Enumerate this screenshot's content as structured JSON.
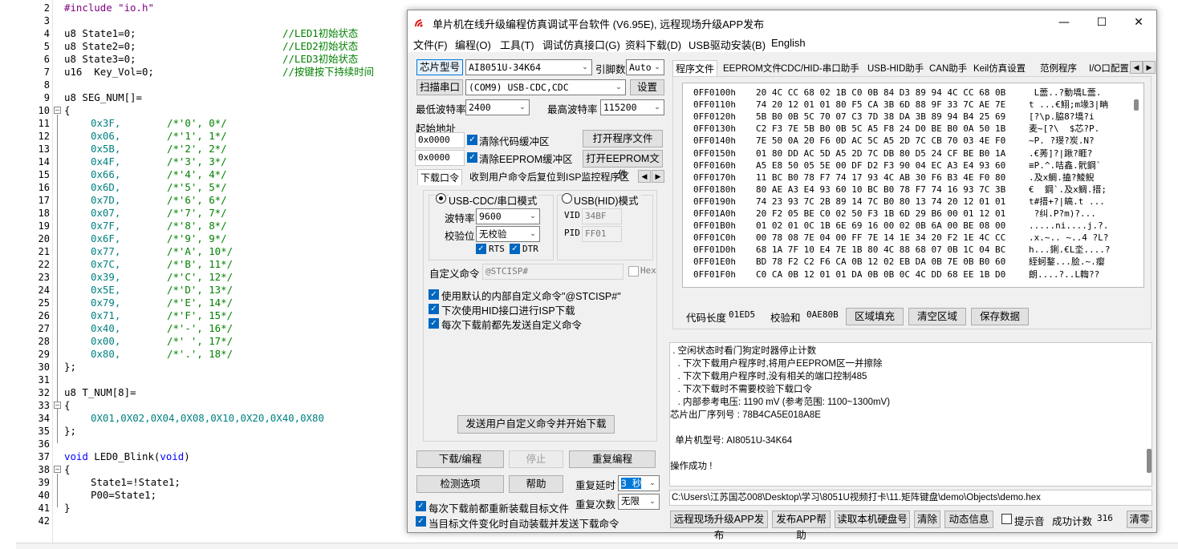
{
  "editor": {
    "line_numbers": [
      "2",
      "3",
      "4",
      "5",
      "6",
      "7",
      "8",
      "9",
      "10",
      "11",
      "12",
      "13",
      "14",
      "15",
      "16",
      "17",
      "18",
      "19",
      "20",
      "21",
      "22",
      "23",
      "24",
      "25",
      "26",
      "27",
      "28",
      "29",
      "30",
      "31",
      "32",
      "33",
      "34",
      "35",
      "36",
      "37",
      "38",
      "39",
      "40",
      "41",
      "42"
    ],
    "lines": {
      "l2_a": "#include ",
      "l2_b": "\"io.h\"",
      "l4_code": "u8 State1=0;",
      "l4_cmt": "//LED1初始状态",
      "l5_code": "u8 State2=0;",
      "l5_cmt": "//LED2初始状态",
      "l6_code": "u8 State3=0;",
      "l6_cmt": "//LED3初始状态",
      "l7_code": "u16  Key_Vol=0;",
      "l7_cmt": "//按键按下持续时间",
      "l9": "u8 SEG_NUM[]=",
      "l10": "{",
      "seg": [
        {
          "v": "0x3F,",
          "c": "/*'0', 0*/"
        },
        {
          "v": "0x06,",
          "c": "/*'1', 1*/"
        },
        {
          "v": "0x5B,",
          "c": "/*'2', 2*/"
        },
        {
          "v": "0x4F,",
          "c": "/*'3', 3*/"
        },
        {
          "v": "0x66,",
          "c": "/*'4', 4*/"
        },
        {
          "v": "0x6D,",
          "c": "/*'5', 5*/"
        },
        {
          "v": "0x7D,",
          "c": "/*'6', 6*/"
        },
        {
          "v": "0x07,",
          "c": "/*'7', 7*/"
        },
        {
          "v": "0x7F,",
          "c": "/*'8', 8*/"
        },
        {
          "v": "0x6F,",
          "c": "/*'9', 9*/"
        },
        {
          "v": "0x77,",
          "c": "/*'A', 10*/"
        },
        {
          "v": "0x7C,",
          "c": "/*'B', 11*/"
        },
        {
          "v": "0x39,",
          "c": "/*'C', 12*/"
        },
        {
          "v": "0x5E,",
          "c": "/*'D', 13*/"
        },
        {
          "v": "0x79,",
          "c": "/*'E', 14*/"
        },
        {
          "v": "0x71,",
          "c": "/*'F', 15*/"
        },
        {
          "v": "0x40,",
          "c": "/*'-', 16*/"
        },
        {
          "v": "0x00,",
          "c": "/*' ', 17*/"
        },
        {
          "v": "0x80,",
          "c": "/*'.', 18*/"
        }
      ],
      "l30": "};",
      "l32": "u8 T_NUM[8]=",
      "l33": "{",
      "l34": "0X01,0X02,0X04,0X08,0X10,0X20,0X40,0X80",
      "l35": "};",
      "l37_kw": "void",
      "l37_name": " LED0_Blink(",
      "l37_kw2": "void",
      "l37_end": ")",
      "l38": "{",
      "l39": "State1=!State1;",
      "l40": "P00=State1;",
      "l41": "}"
    }
  },
  "window": {
    "title": "单片机在线升级编程仿真调试平台软件 (V6.95E), 远程现场升级APP发布",
    "controls": {
      "min": "—",
      "max": "☐",
      "close": "✕"
    },
    "menu": [
      "文件(F)",
      "编程(O)",
      "工具(T)",
      "调试仿真接口(G)",
      "资料下载(D)",
      "USB驱动安装(B)",
      "English"
    ]
  },
  "left": {
    "chip_btn": "芯片型号",
    "chip_value": "AI8051U-34K64",
    "pin_label": "引脚数",
    "pin_value": "Auto",
    "scan_btn": "扫描串口",
    "port_value": "(COM9) USB-CDC,CDC",
    "settings_btn": "设置",
    "min_baud_label": "最低波特率",
    "min_baud": "2400",
    "max_baud_label": "最高波特率",
    "max_baud": "115200",
    "start_addr_label": "起始地址",
    "addr1": "0x0000",
    "clear_code_label": "清除代码缓冲区",
    "open_prog_btn": "打开程序文件",
    "addr2": "0x0000",
    "clear_eeprom_label": "清除EEPROM缓冲区",
    "open_eeprom_btn": "打开EEPROM文件",
    "tab1": "下载口令",
    "tab2": "收到用户命令后复位到ISP监控程序区",
    "mode_cdc": "USB-CDC/串口模式",
    "mode_hid": "USB(HID)模式",
    "baud_label": "波特率",
    "baud_value": "9600",
    "parity_label": "校验位",
    "parity_value": "无校验",
    "rts": "RTS",
    "dtr": "DTR",
    "vid_label": "VID",
    "vid_value": "34BF",
    "pid_label": "PID",
    "pid_value": "FF01",
    "custom_cmd_label": "自定义命令",
    "custom_cmd_value": "@STCISP#",
    "hex_label": "Hex",
    "opt1": "使用默认的内部自定义命令\"@STCISP#\"",
    "opt2": "下次使用HID接口进行ISP下载",
    "opt3": "每次下载前都先发送自定义命令",
    "send_btn": "发送用户自定义命令并开始下载",
    "download_btn": "下载/编程",
    "stop_btn": "停止",
    "reprogram_btn": "重复编程",
    "detect_btn": "检测选项",
    "help_btn": "帮助",
    "repeat_delay_label": "重复延时",
    "repeat_delay_value": "3 秒",
    "repeat_count_label": "重复次数",
    "repeat_count_value": "无限",
    "reload_label": "每次下载前都重新装载目标文件",
    "auto_load_label": "当目标文件变化时自动装载并发送下载命令"
  },
  "right": {
    "tabs": [
      "程序文件",
      "EEPROM文件",
      "CDC/HID-串口助手",
      "USB-HID助手",
      "CAN助手",
      "Keil仿真设置",
      "范例程序",
      "I/O口配置"
    ],
    "hex_rows": [
      {
        "addr": "0FF0100h",
        "bytes": "20 4C CC 68 02 1B C0 0B 84 D3 89 94 4C CC 68 0B",
        "ascii": " L蘦..?動墧L蘦."
      },
      {
        "addr": "0FF0110h",
        "bytes": "74 20 12 01 01 80 F5 CA 3B 6D 88 9F 33 7C AE 7E",
        "ascii": "t ...€鮙;m堟3|畘"
      },
      {
        "addr": "0FF0120h",
        "bytes": "5B B0 0B 5C 70 07 C3 7D 38 DA 3B 89 94 B4 25 69",
        "ascii": "[?\\p.脇8?墧?i"
      },
      {
        "addr": "0FF0130h",
        "bytes": "C2 F3 7E 5B B0 0B 5C A5 F8 24 D0 BE B0 0A 50 1B",
        "ascii": "麦~[?\\  $芯?P."
      },
      {
        "addr": "0FF0140h",
        "bytes": "7E 50 0A 20 F6 0D AC 5C A5 2D 7C CB 70 03 4E F0",
        "ascii": "~P. ?琝?炭.N?"
      },
      {
        "addr": "0FF0150h",
        "bytes": "01 80 DD AC 5D A5 2D 7C DB 80 D5 24 CF BE B0 1A",
        "ascii": ".€莠]?|踿?睚?"
      },
      {
        "addr": "0FF0160h",
        "bytes": "A5 E8 50 05 5E 00 DF D2 F3 90 04 EC A3 E4 93 60",
        "ascii": "≡P.^.咭鑫.骮鋼`"
      },
      {
        "addr": "0FF0170h",
        "bytes": "11 BC B0 78 F7 74 17 93 4C AB 30 F6 B3 4E F0 80",
        "ascii": ".及x鲷.搕?鯪鲵"
      },
      {
        "addr": "0FF0180h",
        "bytes": "80 AE A3 E4 93 60 10 BC B0 78 F7 74 16 93 7C 3B",
        "ascii": "€  鋼`.及x鲷.搢;"
      },
      {
        "addr": "0FF0190h",
        "bytes": "74 23 93 7C 2B 89 14 7C B0 80 13 74 20 12 01 01",
        "ascii": "t#搢+?|皜.t ..."
      },
      {
        "addr": "0FF01A0h",
        "bytes": "20 F2 05 BE C0 02 50 F3 1B 6D 29 B6 00 01 12 01",
        "ascii": " ?纠.P?m)?..."
      },
      {
        "addr": "0FF01B0h",
        "bytes": "01 02 01 0C 1B 6E 69 16 00 02 0B 6A 00 BE 08 00",
        "ascii": ".....ni....j.?."
      },
      {
        "addr": "0FF01C0h",
        "bytes": "00 78 08 7E 04 00 FF 7E 14 1E 34 20 F2 1E 4C CC",
        "ascii": ".x.~.. ~..4 ?L?"
      },
      {
        "addr": "0FF01D0h",
        "bytes": "68 1A 7F 10 E4 7E 1B 80 4C 88 68 07 0B 1C 04 BC",
        "ascii": "h...鋓.€L坔....?"
      },
      {
        "addr": "0FF01E0h",
        "bytes": "BD 78 F2 C2 F6 CA 0B 12 02 EB DA 0B 7E 0B B0 60",
        "ascii": "絰蚵鍪...脍.~.瘿"
      },
      {
        "addr": "0FF01F0h",
        "bytes": "C0 CA 0B 12 01 01 DA 0B 0B 0C 4C DD 68 EE 1B D0",
        "ascii": "朗....?..L輷??"
      }
    ],
    "code_len_label": "代码长度",
    "code_len_value": "01ED5",
    "checksum_label": "校验和",
    "checksum_value": "0AE80B",
    "fill_btn": "区域填充",
    "clear_btn": "清空区域",
    "save_btn": "保存数据",
    "log": [
      " . 空闲状态时看门狗定时器停止计数",
      "   . 下次下载用户程序时,将用户EEPROM区一并擦除",
      "   . 下次下载用户程序时,没有相关的端口控制485",
      "   . 下次下载时不需要校验下载口令",
      "   . 内部参考电压: 1190 mV (参考范围: 1100~1300mV)",
      "芯片出厂序列号 : 78B4CA5E018A8E",
      "",
      "  单片机型号: AI8051U-34K64",
      "",
      "操作成功 !"
    ],
    "path": "C:\\Users\\江苏国芯008\\Desktop\\学习\\8051U视频打卡\\11.矩阵键盘\\demo\\Objects\\demo.hex",
    "bottom": {
      "publish_btn": "远程现场升级APP发布",
      "publish_help_btn": "发布APP帮助",
      "read_disk_btn": "读取本机硬盘号",
      "clear_btn": "清除",
      "dynamic_btn": "动态信息",
      "beep_label": "提示音",
      "success_label": "成功计数",
      "success_count": "316",
      "reset_btn": "清零"
    }
  }
}
